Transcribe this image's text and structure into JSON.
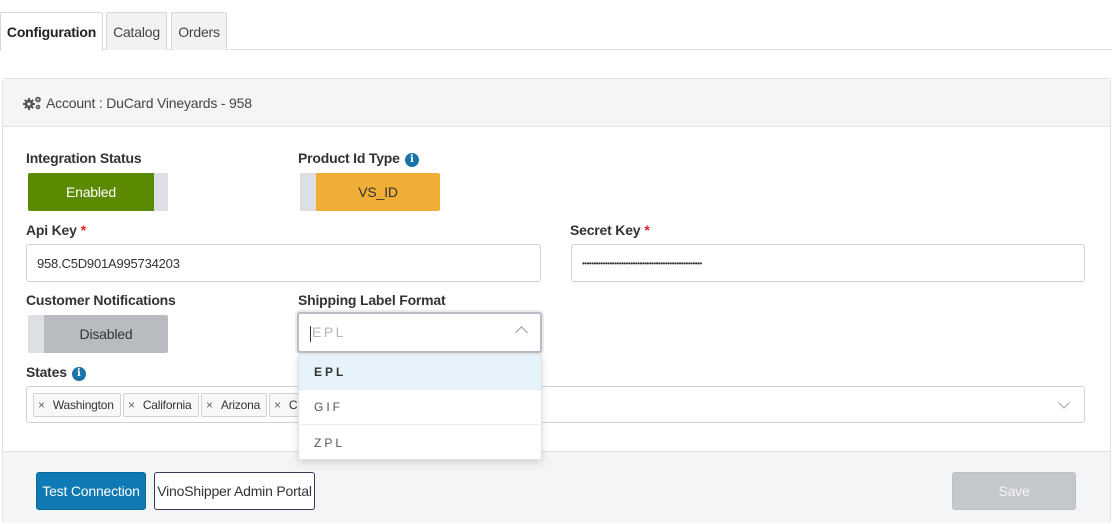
{
  "tabs": [
    {
      "label": "Configuration",
      "active": true
    },
    {
      "label": "Catalog",
      "active": false
    },
    {
      "label": "Orders",
      "active": false
    }
  ],
  "panel": {
    "header_icon": "gears-icon",
    "header_title": "Account : DuCard Vineyards - 958"
  },
  "form": {
    "integration_status": {
      "label": "Integration Status",
      "value": "Enabled",
      "color": "#5b8a00"
    },
    "product_id_type": {
      "label": "Product Id Type",
      "value": "VS_ID",
      "color": "#f0ae36",
      "info_icon": "info-icon"
    },
    "api_key": {
      "label": "Api Key",
      "required": "*",
      "value": "958.C5D901A995734203"
    },
    "secret_key": {
      "label": "Secret Key",
      "required": "*",
      "value": "••••••••••••••••••••••••••••••••••••••••••••••••••••"
    },
    "customer_notifications": {
      "label": "Customer Notifications",
      "value": "Disabled",
      "color": "#b8bcc1"
    },
    "shipping_label_format": {
      "label": "Shipping Label Format",
      "placeholder": "EPL",
      "options": [
        "EPL",
        "GIF",
        "ZPL"
      ],
      "highlighted": "EPL"
    },
    "states": {
      "label": "States",
      "info_icon": "info-icon",
      "chips": [
        "Washington",
        "California",
        "Arizona",
        "C"
      ]
    }
  },
  "footer": {
    "test_connection": "Test Connection",
    "admin_portal": "VinoShipper Admin Portal",
    "save": "Save"
  },
  "colors": {
    "primary": "#0e79b2",
    "enabled": "#5b8a00",
    "product_id": "#f0ae36"
  }
}
